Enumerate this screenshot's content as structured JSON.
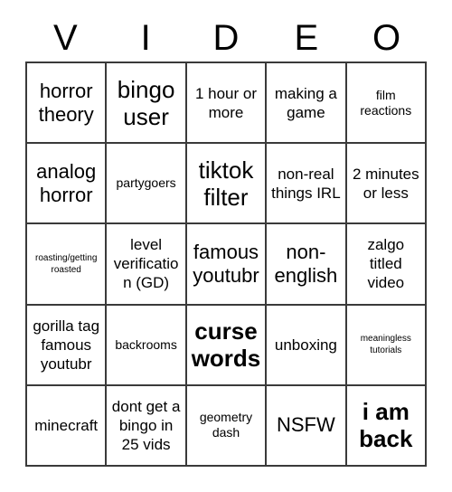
{
  "card": {
    "title_letters": [
      "V",
      "I",
      "D",
      "E",
      "O"
    ],
    "columns": 5,
    "rows": 5,
    "colors": {
      "background": "#ffffff",
      "text": "#000000",
      "grid_line": "#3a3a3a"
    },
    "cells": [
      {
        "text": "horror theory",
        "size": "size-lg"
      },
      {
        "text": "bingo user",
        "size": "size-xl"
      },
      {
        "text": "1 hour or more",
        "size": "size-md"
      },
      {
        "text": "making a game",
        "size": "size-md"
      },
      {
        "text": "film reactions",
        "size": "size-sm"
      },
      {
        "text": "analog horror",
        "size": "size-lg"
      },
      {
        "text": "partygoers",
        "size": "size-sm"
      },
      {
        "text": "tiktok filter",
        "size": "size-xl"
      },
      {
        "text": "non-real things IRL",
        "size": "size-md"
      },
      {
        "text": "2 minutes or less",
        "size": "size-md"
      },
      {
        "text": "roasting/getting roasted",
        "size": "size-xs"
      },
      {
        "text": "level verification (GD)",
        "size": "size-md"
      },
      {
        "text": "famous youtubr",
        "size": "size-lg"
      },
      {
        "text": "non-english",
        "size": "size-lg"
      },
      {
        "text": "zalgo titled video",
        "size": "size-md"
      },
      {
        "text": "gorilla tag famous youtubr",
        "size": "size-md"
      },
      {
        "text": "backrooms",
        "size": "size-sm"
      },
      {
        "text": "curse words",
        "size": "size-xl-b"
      },
      {
        "text": "unboxing",
        "size": "size-md"
      },
      {
        "text": "meaningless tutorials",
        "size": "size-xs"
      },
      {
        "text": "minecraft",
        "size": "size-md"
      },
      {
        "text": "dont get a bingo in 25 vids",
        "size": "size-md"
      },
      {
        "text": "geometry dash",
        "size": "size-sm"
      },
      {
        "text": "NSFW",
        "size": "size-lg"
      },
      {
        "text": "i am back",
        "size": "size-xl-b"
      }
    ]
  }
}
